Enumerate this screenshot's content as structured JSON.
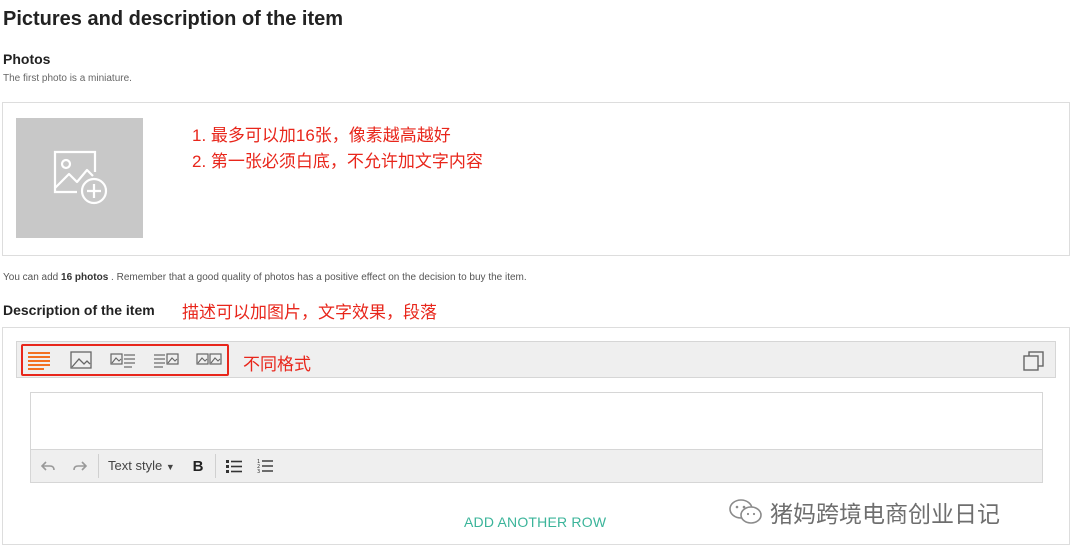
{
  "header": {
    "title": "Pictures and description of the item"
  },
  "photos": {
    "label": "Photos",
    "hint": "The first photo is a miniature.",
    "limit_prefix": "You can add ",
    "limit_count": "16 photos",
    "limit_suffix": " . Remember that a good quality of photos has a positive effect on the decision to buy the item.",
    "add_photo_icon": "image-plus-icon"
  },
  "annotations": {
    "photo_rule_1": "1. 最多可以加16张，像素越高越好",
    "photo_rule_2": "2. 第一张必须白底，不允许加文字内容",
    "description_note": "描述可以加图片，文字效果，段落",
    "format_note": "不同格式",
    "color": "#e8261b"
  },
  "description": {
    "label": "Description of the item",
    "layouts": [
      {
        "name": "text-only",
        "icon": "text-layout-icon",
        "active": true
      },
      {
        "name": "image-only",
        "icon": "image-layout-icon",
        "active": false
      },
      {
        "name": "image-left-text-right",
        "icon": "image-text-layout-icon",
        "active": false
      },
      {
        "name": "text-left-image-right",
        "icon": "text-image-layout-icon",
        "active": false
      },
      {
        "name": "two-images",
        "icon": "two-images-layout-icon",
        "active": false
      }
    ],
    "toolbar": {
      "undo_icon": "undo-icon",
      "redo_icon": "redo-icon",
      "text_style_label": "Text style",
      "bold_label": "B",
      "bullet_list_icon": "bullet-list-icon",
      "numbered_list_icon": "numbered-list-icon"
    },
    "add_row_label": "ADD ANOTHER ROW",
    "duplicate_icon": "copy-icon"
  },
  "watermark": {
    "text": "猪妈跨境电商创业日记",
    "icon": "wechat-icon"
  },
  "colors": {
    "accent_orange": "#f37021",
    "teal": "#3bb49a"
  }
}
